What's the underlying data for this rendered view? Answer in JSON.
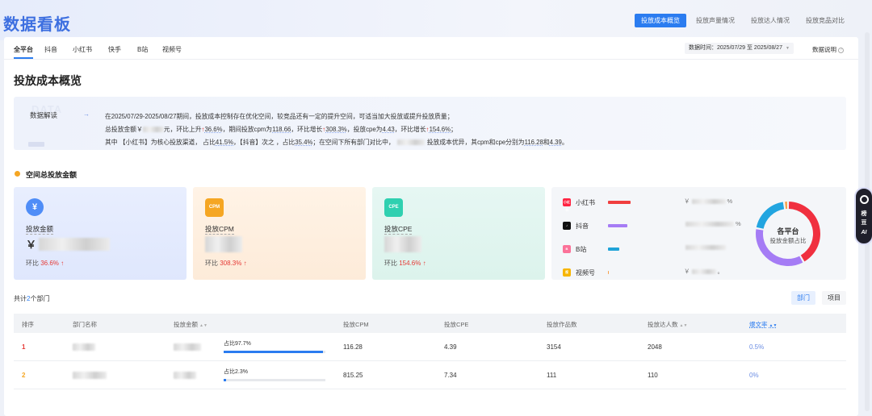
{
  "app": {
    "title": "数据看板"
  },
  "top_tabs": [
    {
      "label": "投放成本概览",
      "active": true
    },
    {
      "label": "投放声量情况",
      "active": false
    },
    {
      "label": "投放达人情况",
      "active": false
    },
    {
      "label": "投放竞品对比",
      "active": false
    }
  ],
  "platform_tabs": [
    {
      "label": "全平台",
      "active": true
    },
    {
      "label": "抖音"
    },
    {
      "label": "小红书"
    },
    {
      "label": "快手"
    },
    {
      "label": "B站"
    },
    {
      "label": "视频号"
    }
  ],
  "date_range": "数据时间：2025/07/29 至 2025/08/27",
  "help_label": "数据说明",
  "section_title": "投放成本概览",
  "insight": {
    "label": "数据解读",
    "watermark": "DATA",
    "line1": "在2025/07/29-2025/08/27期间，投放成本控制存在优化空间，较竞品还有一定的提升空间，可适当加大投放或提升投放质量；",
    "line2": {
      "p1": "总投放金额￥",
      "p2": "元，环比上升",
      "v1": "36.6%",
      "p3": "，期间投放cpm为",
      "v2": "118.66",
      "p4": "，环比增长",
      "v3": "308.3%",
      "p5": "，投放cpe为",
      "v4": "4.43",
      "p6": "，环比增长",
      "v5": "154.6%",
      "p7": "；"
    },
    "line3": {
      "p1": "其中 【小红书】为核心投放渠道， 占比",
      "v1": "41.5%",
      "p2": "，【抖音】次之 ，占比",
      "v2": "35.4%",
      "p3": "；在空间下所有部门对比中，",
      "p4": "投放成本优异，其cpm和cpe分别为",
      "v3": "116.28",
      "p5": "和",
      "v4": "4.39",
      "p6": "。"
    }
  },
  "subsection_title": "空间总投放金额",
  "cards": [
    {
      "label": "投放金额",
      "value_prefix": "￥",
      "ratio_label": "环比",
      "ratio": "36.6%",
      "icon": "yen-icon",
      "color": "#4f8df7"
    },
    {
      "label": "投放CPM",
      "ratio_label": "环比",
      "ratio": "308.3%",
      "icon_text": "CPM",
      "color": "#f5a623"
    },
    {
      "label": "投放CPE",
      "ratio_label": "环比",
      "ratio": "154.6%",
      "icon_text": "CPE",
      "color": "#2fd0b0"
    }
  ],
  "platforms": [
    {
      "name": "小红书",
      "logo": "小红书",
      "color": "#ff2442",
      "bar_color": "#f03e3e",
      "share": 0.415,
      "value": "￥",
      "pct": "%"
    },
    {
      "name": "抖音",
      "logo": "♪",
      "color": "#111111",
      "bar_color": "#a57cf5",
      "share": 0.354,
      "value": "",
      "pct": "%"
    },
    {
      "name": "B站",
      "logo": "B",
      "color": "#fb7299",
      "bar_color": "#1fa3d8",
      "share": 0.2,
      "value": "",
      "pct": ""
    },
    {
      "name": "视频号",
      "logo": "视",
      "color": "#f7b500",
      "bar_color": "#f7a04a",
      "share": 0.02,
      "value": "￥",
      "pct": "。"
    }
  ],
  "donut": {
    "title": "各平台",
    "subtitle": "投放金额占比",
    "colors": [
      "#f0303f",
      "#a57cf5",
      "#22a5e0"
    ]
  },
  "dept_count": {
    "prefix": "共计",
    "count": "2",
    "suffix": "个部门"
  },
  "view_buttons": {
    "dept": "部门",
    "project": "项目"
  },
  "table": {
    "headers": [
      "排序",
      "部门名称",
      "投放金额",
      "投放CPM",
      "投放CPE",
      "投放作品数",
      "投放达人数",
      "爆文率"
    ],
    "rows": [
      {
        "rank": "1",
        "share_label": "占比97.7%",
        "share": 0.977,
        "cpm": "116.28",
        "cpe": "4.39",
        "works": "3154",
        "kols": "2048",
        "viral": "0.5%",
        "rank_color": "#e53935"
      },
      {
        "rank": "2",
        "share_label": "占比2.3%",
        "share": 0.023,
        "cpm": "815.25",
        "cpe": "7.34",
        "works": "111",
        "kols": "110",
        "viral": "0%",
        "rank_color": "#f5a623"
      }
    ]
  },
  "side_ai": {
    "line1": "榜",
    "line2": "豆",
    "line3": "AI"
  }
}
